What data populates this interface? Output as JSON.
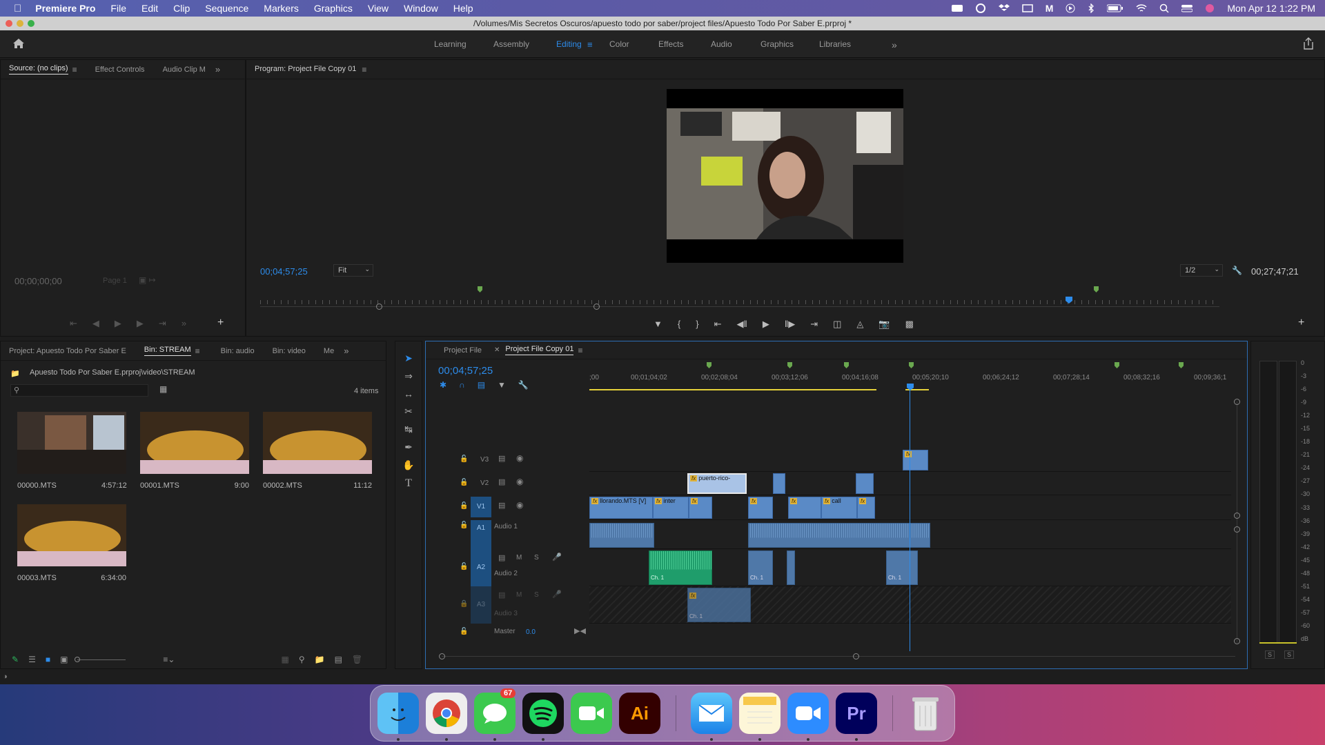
{
  "menubar": {
    "app_name": "Premiere Pro",
    "items": [
      "File",
      "Edit",
      "Clip",
      "Sequence",
      "Markers",
      "Graphics",
      "View",
      "Window",
      "Help"
    ],
    "clock": "Mon Apr 12  1:22 PM"
  },
  "window": {
    "title": "/Volumes/Mis Secretos Oscuros/apuesto todo por saber/project files/Apuesto Todo Por Saber E.prproj *"
  },
  "workspaces": {
    "items": [
      "Learning",
      "Assembly",
      "Editing",
      "Color",
      "Effects",
      "Audio",
      "Graphics",
      "Libraries"
    ],
    "active": "Editing"
  },
  "source_panel": {
    "tabs": [
      "Source: (no clips)",
      "Effect Controls",
      "Audio Clip M"
    ],
    "timecode": "00;00;00;00",
    "page": "Page 1"
  },
  "program_panel": {
    "tab": "Program: Project File Copy 01",
    "timecode": "00;04;57;25",
    "fit": "Fit",
    "resolution": "1/2",
    "duration": "00;27;47;21"
  },
  "project_panel": {
    "tabs": [
      "Project: Apuesto Todo Por Saber E",
      "Bin: STREAM",
      "Bin: audio",
      "Bin: video",
      "Me"
    ],
    "path": "Apuesto Todo Por Saber E.prproj\\video\\STREAM",
    "item_count": "4 items",
    "items": [
      {
        "name": "00000.MTS",
        "duration": "4:57:12"
      },
      {
        "name": "00001.MTS",
        "duration": "9:00"
      },
      {
        "name": "00002.MTS",
        "duration": "11:12"
      },
      {
        "name": "00003.MTS",
        "duration": "6:34:00"
      }
    ]
  },
  "timeline": {
    "tabs": [
      "Project File",
      "Project File Copy 01"
    ],
    "timecode": "00;04;57;25",
    "ruler": [
      ";00",
      "00;01;04;02",
      "00;02;08;04",
      "00;03;12;06",
      "00;04;16;08",
      "00;05;20;10",
      "00;06;24;12",
      "00;07;28;14",
      "00;08;32;16",
      "00;09;36;1"
    ],
    "tracks": {
      "v3": "V3",
      "v2": "V2",
      "v1": "V1",
      "a1": "A1",
      "a1_name": "Audio 1",
      "a2": "A2",
      "a2_name": "Audio 2",
      "a3": "A3",
      "a3_name": "Audio 3",
      "master": "Master",
      "master_value": "0.0"
    },
    "clips": {
      "v2_title": "puerto-rico-",
      "v1_llorando": "llorando.MTS [V]",
      "v1_inter": "inter",
      "v1_call": "call",
      "ch1": "Ch. 1"
    },
    "fx": "fx",
    "mute": "M",
    "solo": "S"
  },
  "meter": {
    "scale": [
      "0",
      "-3",
      "-6",
      "-9",
      "-12",
      "-15",
      "-18",
      "-21",
      "-24",
      "-27",
      "-30",
      "-33",
      "-36",
      "-39",
      "-42",
      "-45",
      "-48",
      "-51",
      "-54",
      "-57",
      "-60",
      "dB"
    ],
    "solo_left": "S",
    "solo_right": "S"
  },
  "dock": {
    "items": [
      "Finder",
      "Chrome",
      "Messages",
      "Spotify",
      "FaceTime",
      "Illustrator",
      "Mail",
      "Notes",
      "Zoom",
      "Premiere Pro",
      "Trash"
    ],
    "messages_badge": "67",
    "illustrator_label": "Ai",
    "premiere_label": "Pr"
  },
  "colors": {
    "accent": "#2d8ceb",
    "clip_video": "#5a8ac6",
    "clip_audio": "#4f78a8",
    "clip_green": "#1f9d6b",
    "marker": "#6aa84f",
    "fx": "#e0b33a"
  }
}
